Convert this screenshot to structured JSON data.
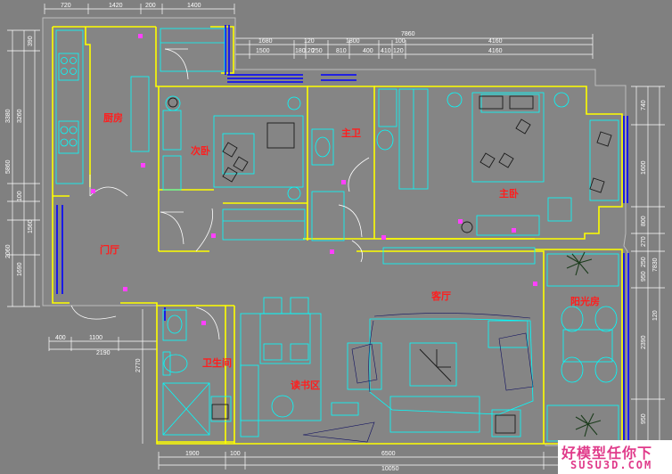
{
  "colors": {
    "background": "#808080",
    "wall": "#ffff00",
    "furniture": "#00ffff",
    "window": "#0000ff",
    "label": "#ff1e1e",
    "dimension": "#ffffff",
    "watermark": "#e03a8a"
  },
  "rooms": {
    "kitchen": "厨房",
    "second_bedroom": "次卧",
    "master_bath": "主卫",
    "master_bedroom": "主卧",
    "foyer": "门厅",
    "living_room": "客厅",
    "sunroom": "阳光房",
    "bathroom": "卫生间",
    "study": "读书区"
  },
  "dimensions": {
    "top": {
      "row1": [
        "720",
        "1420",
        "200",
        "1400"
      ],
      "row2": [
        "7860"
      ],
      "row3": [
        "1680",
        "120",
        "1800",
        "100",
        "4160"
      ],
      "row4": [
        "1500",
        "180",
        "120",
        "250",
        "810",
        "400",
        "410",
        "120",
        "4160"
      ]
    },
    "left": {
      "outer": [
        "5860",
        "2060",
        "1690"
      ],
      "inner": [
        "3380",
        "3260",
        "100",
        "1560",
        "390"
      ]
    },
    "right": [
      "740",
      "1600",
      "800",
      "270",
      "250",
      "950",
      "2390",
      "950",
      "7830",
      "120"
    ],
    "bottom": {
      "row1": [
        "400",
        "1100",
        "2190",
        "2770"
      ],
      "row2": [
        "1900",
        "100",
        "6500",
        "10050"
      ]
    }
  },
  "watermark": {
    "line1": "好模型任你下",
    "line2": "SUSU3D.COM"
  }
}
